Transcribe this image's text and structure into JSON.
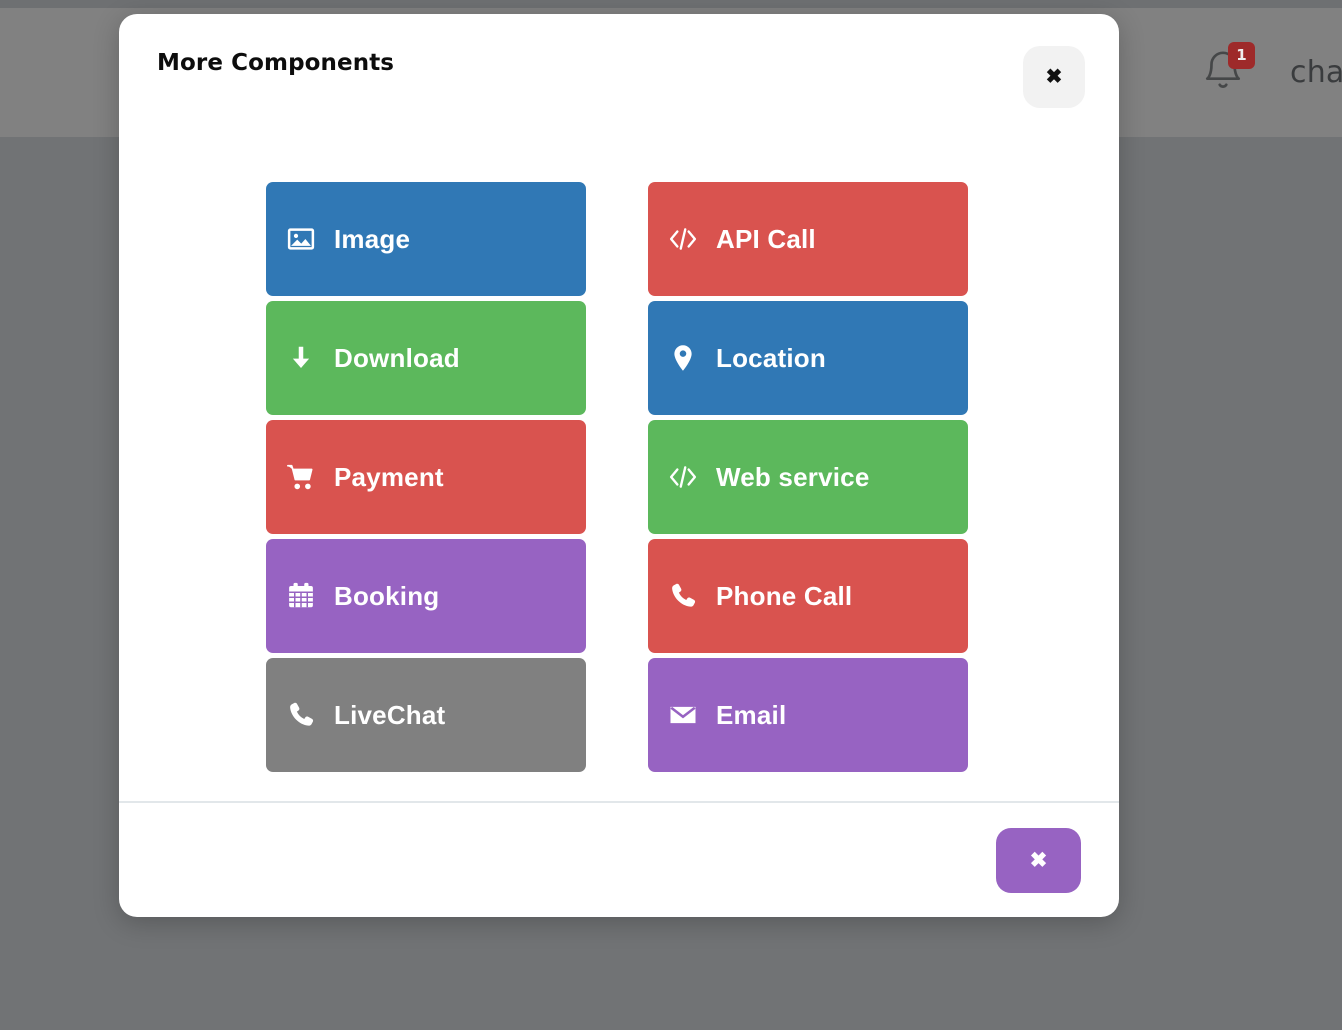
{
  "background": {
    "header": {
      "fullscreen_icon": "fullscreen-icon",
      "notifications_icon": "bell-icon",
      "notifications_count": "1",
      "brand_text": "cha"
    }
  },
  "modal": {
    "title": "More Components",
    "header_close_label": "✖",
    "footer_close_label": "✖",
    "colors": {
      "blue": "#3078b5",
      "green": "#5cb85c",
      "red": "#d9534f",
      "purple": "#9763c2",
      "gray": "#808080",
      "accent": "#9763c2",
      "divider": "#e2e7ea",
      "header_close_bg": "#f2f2f2"
    },
    "columns": [
      {
        "name": "left-column",
        "tiles": [
          {
            "label": "Image",
            "icon": "image-icon",
            "color": "#3078b5"
          },
          {
            "label": "Download",
            "icon": "download-icon",
            "color": "#5cb85c"
          },
          {
            "label": "Payment",
            "icon": "cart-icon",
            "color": "#d9534f"
          },
          {
            "label": "Booking",
            "icon": "calendar-icon",
            "color": "#9763c2"
          },
          {
            "label": "LiveChat",
            "icon": "phone-icon",
            "color": "#808080"
          }
        ]
      },
      {
        "name": "right-column",
        "tiles": [
          {
            "label": "API Call",
            "icon": "code-icon",
            "color": "#d9534f"
          },
          {
            "label": "Location",
            "icon": "map-pin-icon",
            "color": "#3078b5"
          },
          {
            "label": "Web service",
            "icon": "code-icon",
            "color": "#5cb85c"
          },
          {
            "label": "Phone Call",
            "icon": "phone-icon",
            "color": "#d9534f"
          },
          {
            "label": "Email",
            "icon": "envelope-icon",
            "color": "#9763c2"
          }
        ]
      }
    ]
  }
}
